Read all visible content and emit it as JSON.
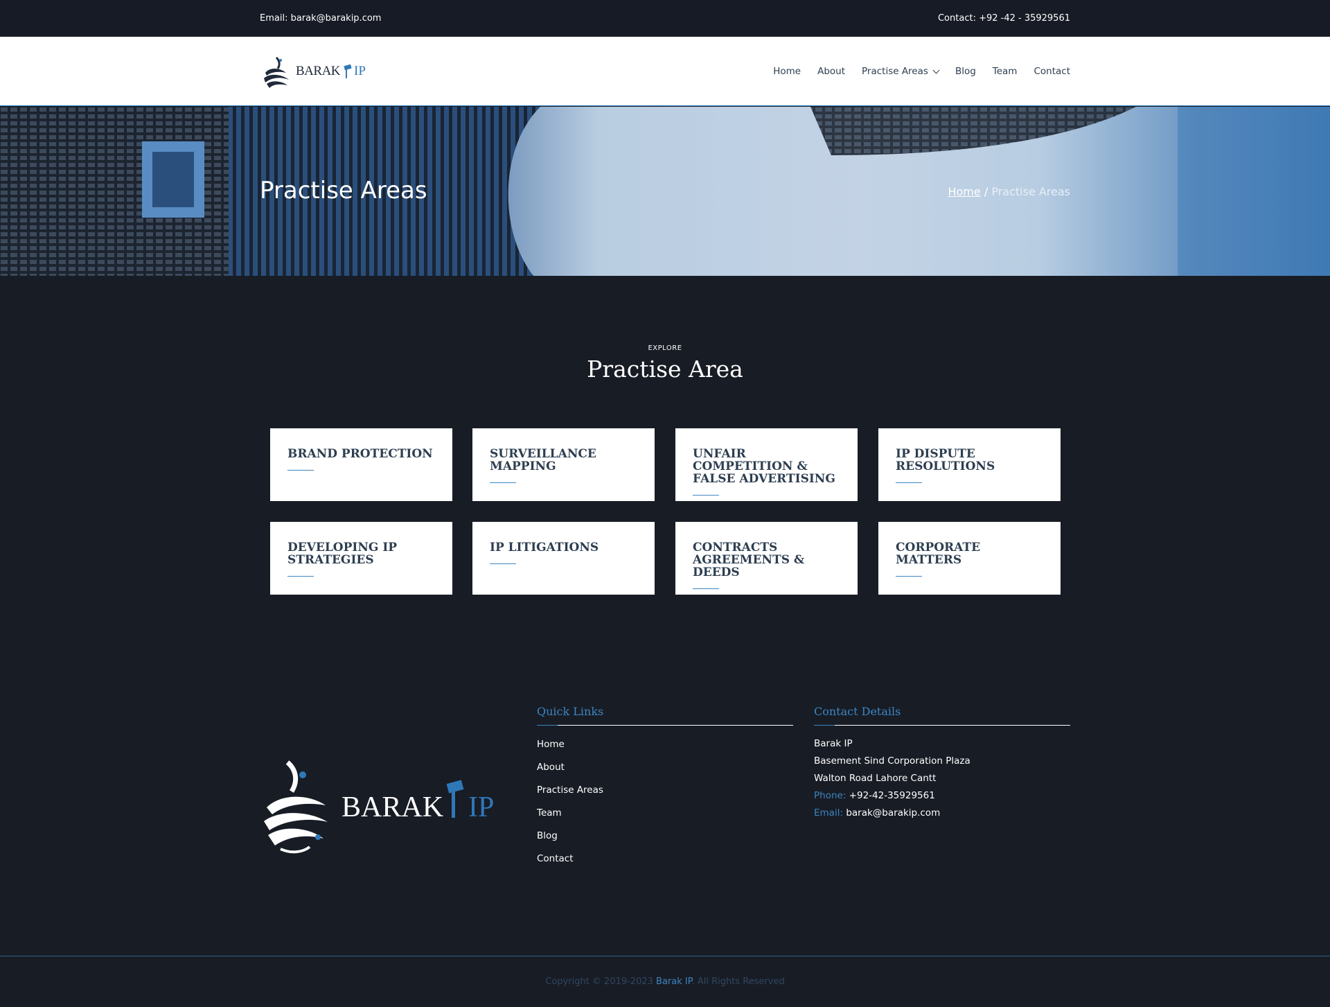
{
  "topbar": {
    "email": "Email: barak@barakip.com",
    "contact": "Contact:  +92 -42 - 35929561"
  },
  "logo": {
    "word": "BARAK",
    "ip": "IP"
  },
  "nav": {
    "items": [
      "Home",
      "About",
      "Practise Areas",
      "Blog",
      "Team",
      "Contact"
    ]
  },
  "hero": {
    "title": "Practise Areas",
    "breadcrumb_home": "Home",
    "breadcrumb_sep": "/",
    "breadcrumb_current": "Practise Areas"
  },
  "section": {
    "eyebrow": "EXPLORE",
    "title": "Practise Area"
  },
  "cards": [
    "BRAND PROTECTION",
    "SURVEILLANCE MAPPING",
    "UNFAIR COMPETITION & FALSE ADVERTISING",
    "IP DISPUTE RESOLUTIONS",
    "DEVELOPING IP STRATEGIES",
    "IP LITIGATIONS",
    "CONTRACTS AGREEMENTS & DEEDS",
    "CORPORATE MATTERS"
  ],
  "footer": {
    "quick_links_title": "Quick Links",
    "quick_links": [
      "Home",
      "About",
      "Practise Areas",
      "Team",
      "Blog",
      "Contact"
    ],
    "contact_title": "Contact Details",
    "company": "Barak IP",
    "address1": "Basement Sind Corporation Plaza",
    "address2": "Walton Road Lahore Cantt",
    "phone_label": "Phone:",
    "phone": "+92-42-35929561",
    "email_label": "Email:",
    "email": "barak@barakip.com"
  },
  "copyright": {
    "prefix": "Copyright © 2019-2023 ",
    "brand": "Barak IP",
    "suffix": ". All Rights Reserved"
  },
  "colors": {
    "accent": "#3c86c1",
    "dark": "#181c25",
    "text_dark": "#2d3e50"
  }
}
